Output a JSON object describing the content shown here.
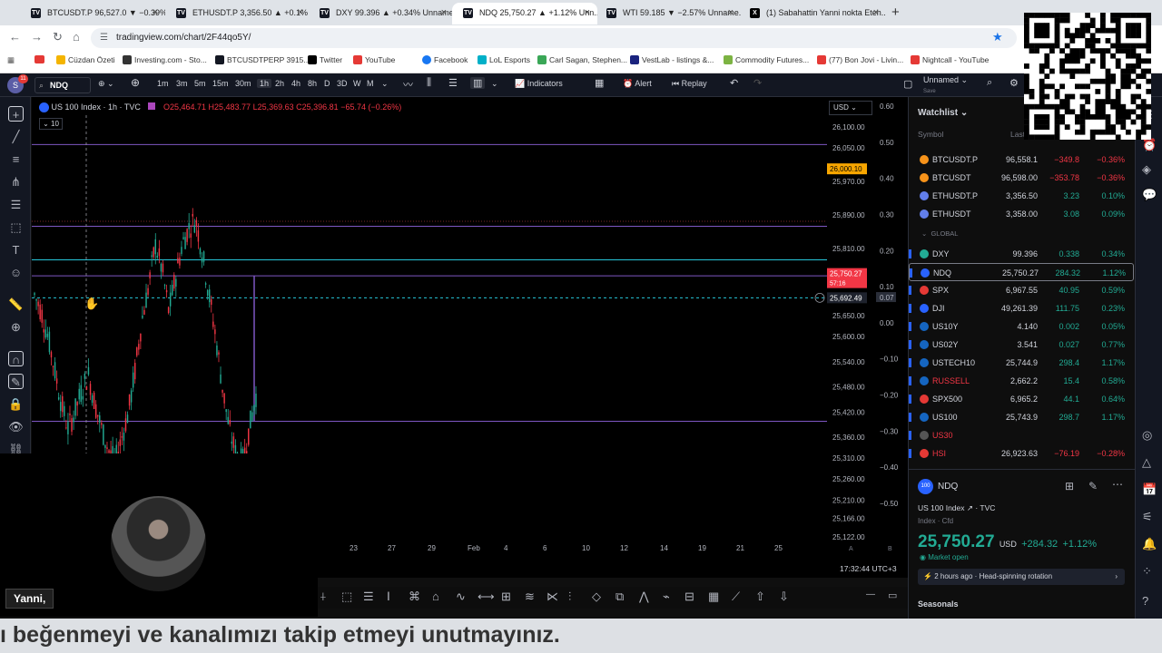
{
  "browser": {
    "tabs": [
      {
        "label": "BTCUSDT.P 96,527.0 ▼ −0.39% ...",
        "active": false
      },
      {
        "label": "ETHUSDT.P 3,356.50 ▲ +0.1% ...",
        "active": false
      },
      {
        "label": "DXY 99.396 ▲ +0.34% Unname...",
        "active": false
      },
      {
        "label": "NDQ 25,750.27 ▲ +1.12% Unn...",
        "active": true
      },
      {
        "label": "WTI 59.185 ▼ −2.57% Unname...",
        "active": false
      },
      {
        "label": "(1) Sabahattin Yanni nokta Eteh...",
        "active": false
      }
    ],
    "url": "tradingview.com/chart/2F44qo5Y/",
    "bookmarks": [
      "Cüzdan Özeti",
      "Investing.com - Sto...",
      "BTCUSDTPERP 3915...",
      "Twitter",
      "YouTube",
      "Facebook",
      "LoL Esports",
      "Carl Sagan, Stephen...",
      "VestLab - listings &...",
      "Commodity Futures...",
      "(77) Bon Jovi - Livin...",
      "Nightcall - YouTube"
    ]
  },
  "toolbar": {
    "avatar": "S",
    "avatar_badge": "11",
    "symbol": "NDQ",
    "intervals": [
      "1m",
      "3m",
      "5m",
      "15m",
      "30m",
      "1h",
      "2h",
      "4h",
      "8h",
      "D",
      "3D",
      "W",
      "M"
    ],
    "selected_interval": "1h",
    "indicators_label": "Indicators",
    "alert_label": "Alert",
    "replay_label": "Replay",
    "layout_name": "Unnamed",
    "layout_status": "Save"
  },
  "chart": {
    "legend_title": "US 100 Index · 1h · TVC",
    "open": "O25,464.71",
    "high": "H25,483.77",
    "low": "L25,369.63",
    "close": "C25,396.81",
    "change": "−65.74 (−0.26%)",
    "pane_badge": "10",
    "currency": "USD",
    "price_ticks": [
      "26,100.00",
      "26,050.00",
      "25,970.00",
      "25,890.00",
      "25,810.00",
      "25,650.00",
      "25,600.00",
      "25,540.00",
      "25,480.00",
      "25,420.00",
      "25,360.00",
      "25,310.00",
      "25,260.00",
      "25,210.00",
      "25,166.00",
      "25,122.00"
    ],
    "osc_ticks": [
      "0.60",
      "0.50",
      "0.40",
      "0.30",
      "0.20",
      "0.10",
      "0.07",
      "0.00",
      "−0.10",
      "−0.20",
      "−0.30",
      "−0.40",
      "−0.50"
    ],
    "price_label_level": "26,000.10",
    "price_label_last": "25,750.27",
    "price_label_countdown": "57:16",
    "price_label_cross": "25,692.49",
    "time_ticks": [
      "23",
      "27",
      "29",
      "Feb",
      "4",
      "6",
      "10",
      "12",
      "14",
      "19",
      "21",
      "25"
    ],
    "clock": "17:32:44 UTC+3",
    "scale_a": "A",
    "scale_b": "B"
  },
  "overlay": {
    "caption": "Yanni,",
    "subtitle": "ı beğenmeyi ve kanalımızı takip etmeyi unutmayınız."
  },
  "watchlist": {
    "title": "Watchlist",
    "headers": {
      "symbol": "Symbol",
      "last": "Last"
    },
    "group": "GLOBAL",
    "rows": [
      {
        "sym": "BTCUSDT.P",
        "last": "96,558.1",
        "chg": "−349.8",
        "pct": "−0.36%",
        "dir": "neg",
        "color": "#f7931a"
      },
      {
        "sym": "BTCUSDT",
        "last": "96,598.00",
        "chg": "−353.78",
        "pct": "−0.36%",
        "dir": "neg",
        "color": "#f7931a"
      },
      {
        "sym": "ETHUSDT.P",
        "last": "3,356.50",
        "chg": "3.23",
        "pct": "0.10%",
        "dir": "pos",
        "color": "#627eea"
      },
      {
        "sym": "ETHUSDT",
        "last": "3,358.00",
        "chg": "3.08",
        "pct": "0.09%",
        "dir": "pos",
        "color": "#627eea"
      },
      {
        "sym": "DXY",
        "last": "99.396",
        "chg": "0.338",
        "pct": "0.34%",
        "dir": "pos",
        "color": "#22ab94"
      },
      {
        "sym": "NDQ",
        "last": "25,750.27",
        "chg": "284.32",
        "pct": "1.12%",
        "dir": "pos",
        "color": "#2962ff"
      },
      {
        "sym": "SPX",
        "last": "6,967.55",
        "chg": "40.95",
        "pct": "0.59%",
        "dir": "pos",
        "color": "#e53935"
      },
      {
        "sym": "DJI",
        "last": "49,261.39",
        "chg": "111.75",
        "pct": "0.23%",
        "dir": "pos",
        "color": "#2962ff"
      },
      {
        "sym": "US10Y",
        "last": "4.140",
        "chg": "0.002",
        "pct": "0.05%",
        "dir": "pos",
        "color": "#1565c0"
      },
      {
        "sym": "US02Y",
        "last": "3.541",
        "chg": "0.027",
        "pct": "0.77%",
        "dir": "pos",
        "color": "#1565c0"
      },
      {
        "sym": "USTECH10",
        "last": "25,744.9",
        "chg": "298.4",
        "pct": "1.17%",
        "dir": "pos",
        "color": "#1565c0"
      },
      {
        "sym": "RUSSELL",
        "last": "2,662.2",
        "chg": "15.4",
        "pct": "0.58%",
        "dir": "pos",
        "color": "#1565c0"
      },
      {
        "sym": "SPX500",
        "last": "6,965.2",
        "chg": "44.1",
        "pct": "0.64%",
        "dir": "pos",
        "color": "#e53935"
      },
      {
        "sym": "US100",
        "last": "25,743.9",
        "chg": "298.7",
        "pct": "1.17%",
        "dir": "pos",
        "color": "#1565c0"
      },
      {
        "sym": "US30",
        "last": "",
        "chg": "",
        "pct": "",
        "dir": "neg",
        "color": "#555555"
      },
      {
        "sym": "HSI",
        "last": "26,923.63",
        "chg": "−76.19",
        "pct": "−0.28%",
        "dir": "neg",
        "color": "#e53935"
      }
    ]
  },
  "details": {
    "symbol": "NDQ",
    "name": "US 100 Index",
    "exchange": "TVC",
    "type": "Index · Cfd",
    "price": "25,750.27",
    "currency": "USD",
    "change": "+284.32",
    "change_pct": "+1.12%",
    "market_status": "Market open",
    "news": "2 hours ago · Head-spinning rotation",
    "seasonals": "Seasonals"
  },
  "colors": {
    "up": "#22ab94",
    "down": "#f23645",
    "level_line": "#7e57c2",
    "cyan_line": "#26c6da",
    "accent": "#2962ff"
  }
}
